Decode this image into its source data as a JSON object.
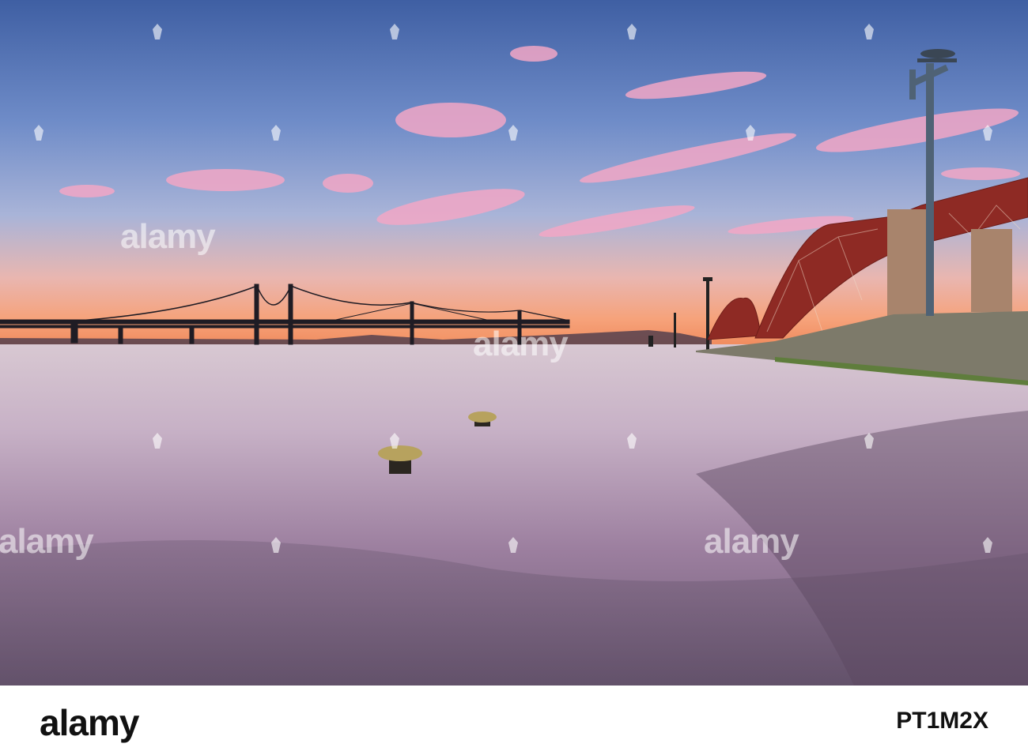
{
  "watermark": {
    "text": "alamy"
  },
  "footer": {
    "logo": "alamy",
    "image_id": "PT1M2X"
  }
}
